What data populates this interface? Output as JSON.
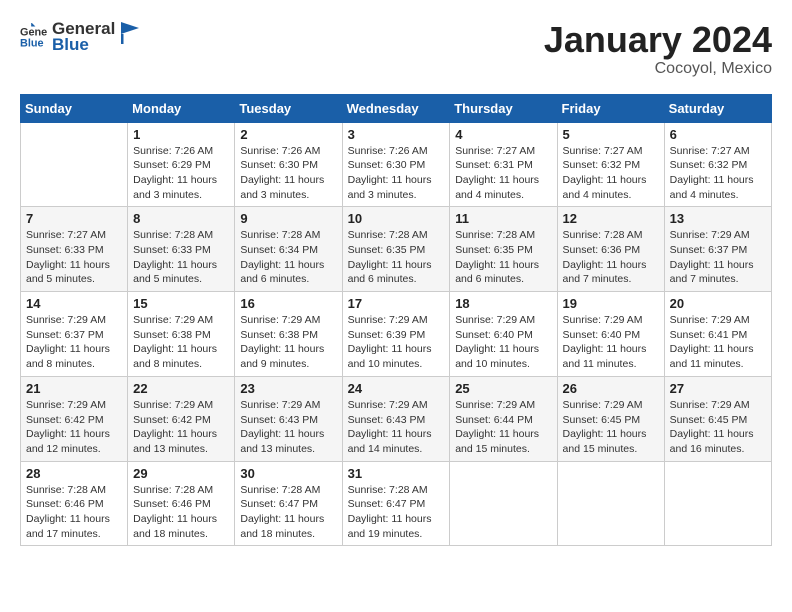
{
  "header": {
    "logo_general": "General",
    "logo_blue": "Blue",
    "month_year": "January 2024",
    "location": "Cocoyol, Mexico"
  },
  "columns": [
    "Sunday",
    "Monday",
    "Tuesday",
    "Wednesday",
    "Thursday",
    "Friday",
    "Saturday"
  ],
  "weeks": [
    [
      {
        "day": "",
        "info": ""
      },
      {
        "day": "1",
        "info": "Sunrise: 7:26 AM\nSunset: 6:29 PM\nDaylight: 11 hours\nand 3 minutes."
      },
      {
        "day": "2",
        "info": "Sunrise: 7:26 AM\nSunset: 6:30 PM\nDaylight: 11 hours\nand 3 minutes."
      },
      {
        "day": "3",
        "info": "Sunrise: 7:26 AM\nSunset: 6:30 PM\nDaylight: 11 hours\nand 3 minutes."
      },
      {
        "day": "4",
        "info": "Sunrise: 7:27 AM\nSunset: 6:31 PM\nDaylight: 11 hours\nand 4 minutes."
      },
      {
        "day": "5",
        "info": "Sunrise: 7:27 AM\nSunset: 6:32 PM\nDaylight: 11 hours\nand 4 minutes."
      },
      {
        "day": "6",
        "info": "Sunrise: 7:27 AM\nSunset: 6:32 PM\nDaylight: 11 hours\nand 4 minutes."
      }
    ],
    [
      {
        "day": "7",
        "info": "Sunrise: 7:27 AM\nSunset: 6:33 PM\nDaylight: 11 hours\nand 5 minutes."
      },
      {
        "day": "8",
        "info": "Sunrise: 7:28 AM\nSunset: 6:33 PM\nDaylight: 11 hours\nand 5 minutes."
      },
      {
        "day": "9",
        "info": "Sunrise: 7:28 AM\nSunset: 6:34 PM\nDaylight: 11 hours\nand 6 minutes."
      },
      {
        "day": "10",
        "info": "Sunrise: 7:28 AM\nSunset: 6:35 PM\nDaylight: 11 hours\nand 6 minutes."
      },
      {
        "day": "11",
        "info": "Sunrise: 7:28 AM\nSunset: 6:35 PM\nDaylight: 11 hours\nand 6 minutes."
      },
      {
        "day": "12",
        "info": "Sunrise: 7:28 AM\nSunset: 6:36 PM\nDaylight: 11 hours\nand 7 minutes."
      },
      {
        "day": "13",
        "info": "Sunrise: 7:29 AM\nSunset: 6:37 PM\nDaylight: 11 hours\nand 7 minutes."
      }
    ],
    [
      {
        "day": "14",
        "info": "Sunrise: 7:29 AM\nSunset: 6:37 PM\nDaylight: 11 hours\nand 8 minutes."
      },
      {
        "day": "15",
        "info": "Sunrise: 7:29 AM\nSunset: 6:38 PM\nDaylight: 11 hours\nand 8 minutes."
      },
      {
        "day": "16",
        "info": "Sunrise: 7:29 AM\nSunset: 6:38 PM\nDaylight: 11 hours\nand 9 minutes."
      },
      {
        "day": "17",
        "info": "Sunrise: 7:29 AM\nSunset: 6:39 PM\nDaylight: 11 hours\nand 10 minutes."
      },
      {
        "day": "18",
        "info": "Sunrise: 7:29 AM\nSunset: 6:40 PM\nDaylight: 11 hours\nand 10 minutes."
      },
      {
        "day": "19",
        "info": "Sunrise: 7:29 AM\nSunset: 6:40 PM\nDaylight: 11 hours\nand 11 minutes."
      },
      {
        "day": "20",
        "info": "Sunrise: 7:29 AM\nSunset: 6:41 PM\nDaylight: 11 hours\nand 11 minutes."
      }
    ],
    [
      {
        "day": "21",
        "info": "Sunrise: 7:29 AM\nSunset: 6:42 PM\nDaylight: 11 hours\nand 12 minutes."
      },
      {
        "day": "22",
        "info": "Sunrise: 7:29 AM\nSunset: 6:42 PM\nDaylight: 11 hours\nand 13 minutes."
      },
      {
        "day": "23",
        "info": "Sunrise: 7:29 AM\nSunset: 6:43 PM\nDaylight: 11 hours\nand 13 minutes."
      },
      {
        "day": "24",
        "info": "Sunrise: 7:29 AM\nSunset: 6:43 PM\nDaylight: 11 hours\nand 14 minutes."
      },
      {
        "day": "25",
        "info": "Sunrise: 7:29 AM\nSunset: 6:44 PM\nDaylight: 11 hours\nand 15 minutes."
      },
      {
        "day": "26",
        "info": "Sunrise: 7:29 AM\nSunset: 6:45 PM\nDaylight: 11 hours\nand 15 minutes."
      },
      {
        "day": "27",
        "info": "Sunrise: 7:29 AM\nSunset: 6:45 PM\nDaylight: 11 hours\nand 16 minutes."
      }
    ],
    [
      {
        "day": "28",
        "info": "Sunrise: 7:28 AM\nSunset: 6:46 PM\nDaylight: 11 hours\nand 17 minutes."
      },
      {
        "day": "29",
        "info": "Sunrise: 7:28 AM\nSunset: 6:46 PM\nDaylight: 11 hours\nand 18 minutes."
      },
      {
        "day": "30",
        "info": "Sunrise: 7:28 AM\nSunset: 6:47 PM\nDaylight: 11 hours\nand 18 minutes."
      },
      {
        "day": "31",
        "info": "Sunrise: 7:28 AM\nSunset: 6:47 PM\nDaylight: 11 hours\nand 19 minutes."
      },
      {
        "day": "",
        "info": ""
      },
      {
        "day": "",
        "info": ""
      },
      {
        "day": "",
        "info": ""
      }
    ]
  ]
}
